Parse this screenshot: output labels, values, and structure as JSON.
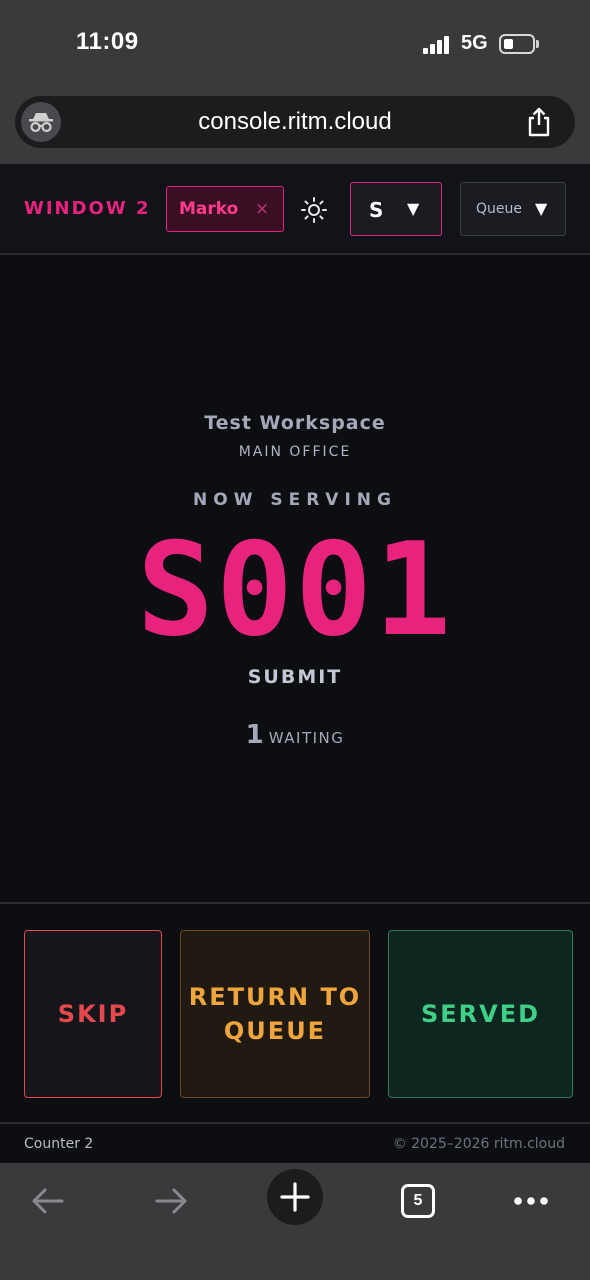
{
  "status_bar": {
    "time": "11:09",
    "network": "5G"
  },
  "browser": {
    "url": "console.ritm.cloud",
    "tab_count": "5"
  },
  "header": {
    "window_title": "WINDOW 2",
    "agent_name": "Marko",
    "agent_close": "×",
    "service_select": {
      "value": "S",
      "caret": "▼"
    },
    "queue_select": {
      "value": "Queue",
      "caret": "▼"
    }
  },
  "main": {
    "workspace": "Test Workspace",
    "office": "MAIN OFFICE",
    "now_serving_label": "NOW SERVING",
    "ticket_number": "S001",
    "service_name": "SUBMIT",
    "waiting_count": "1",
    "waiting_label": "WAITING"
  },
  "actions": {
    "skip": "SKIP",
    "return": "RETURN TO QUEUE",
    "served": "SERVED"
  },
  "footer": {
    "counter": "Counter 2",
    "copyright": "© 2025–2026 ritm.cloud"
  },
  "colors": {
    "accent": "#e8237e",
    "skip": "#e5484d",
    "return": "#f0a53c",
    "served": "#3fcf87",
    "background": "#0d0e12"
  }
}
